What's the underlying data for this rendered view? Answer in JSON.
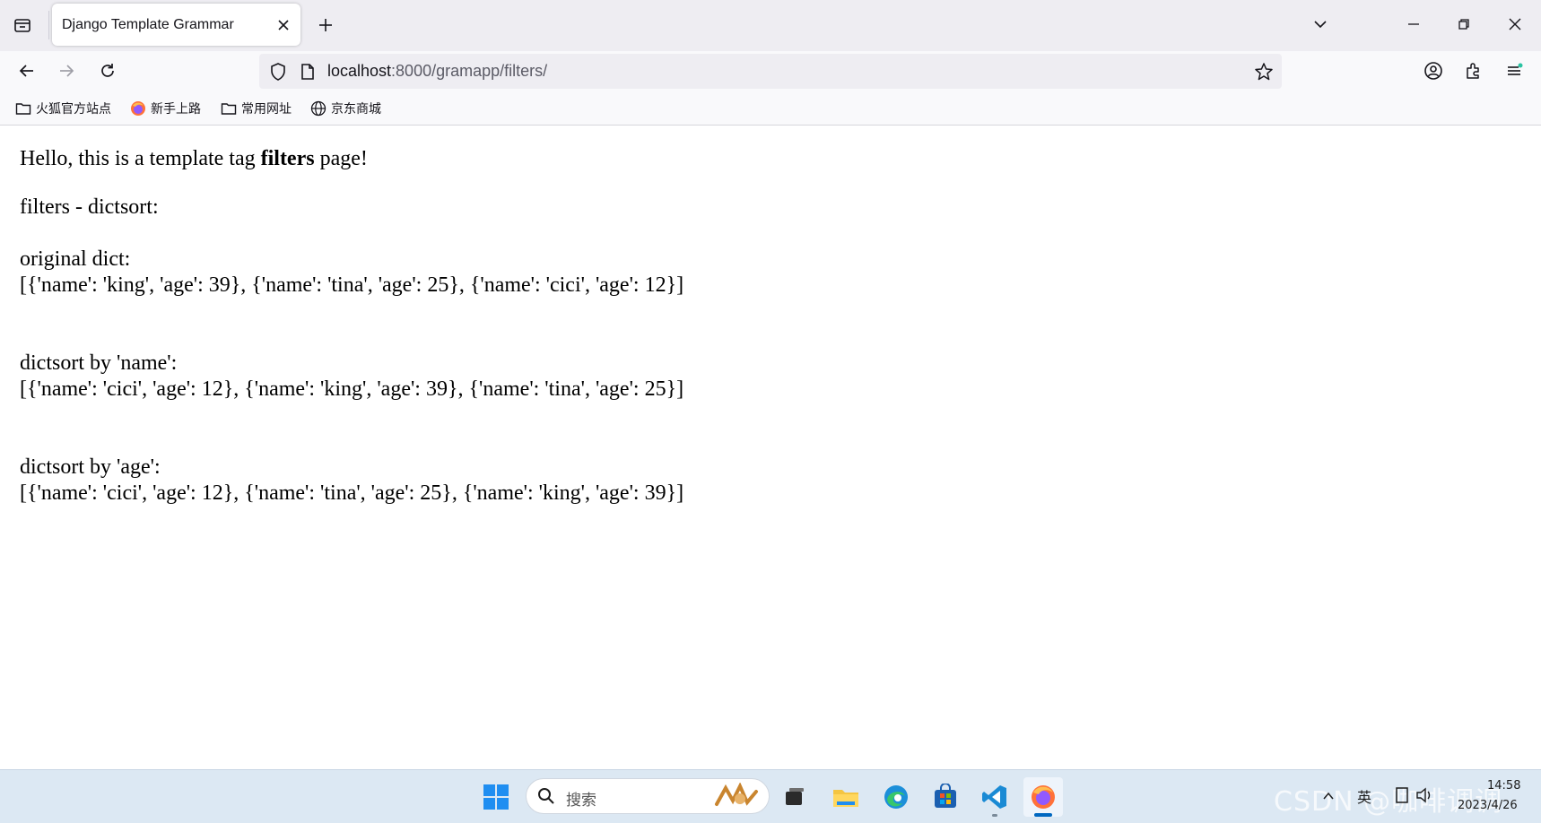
{
  "tab": {
    "title": "Django Template Grammar"
  },
  "address_bar": {
    "host": "localhost",
    "path": ":8000/gramapp/filters/"
  },
  "bookmarks": [
    {
      "label": "火狐官方站点",
      "icon": "folder-icon"
    },
    {
      "label": "新手上路",
      "icon": "firefox-icon"
    },
    {
      "label": "常用网址",
      "icon": "folder-icon"
    },
    {
      "label": "京东商城",
      "icon": "globe-icon"
    }
  ],
  "page": {
    "intro_before": "Hello, this is a template tag ",
    "intro_bold": "filters",
    "intro_after": " page!",
    "section_title": "filters - dictsort:",
    "original_label": "original dict:",
    "original_value": "[{'name': 'king', 'age': 39}, {'name': 'tina', 'age': 25}, {'name': 'cici', 'age': 12}]",
    "by_name_label": "dictsort by 'name':",
    "by_name_value": "[{'name': 'cici', 'age': 12}, {'name': 'king', 'age': 39}, {'name': 'tina', 'age': 25}]",
    "by_age_label": "dictsort by 'age':",
    "by_age_value": "[{'name': 'cici', 'age': 12}, {'name': 'tina', 'age': 25}, {'name': 'king', 'age': 39}]"
  },
  "taskbar": {
    "search_placeholder": "搜索",
    "tray_lang": "英",
    "time": "14:58",
    "date": "2023/4/26",
    "watermark": "CSDN @咖啡调调"
  },
  "colors": {
    "accent": "#0067c0",
    "tabstrip_bg": "#eeedf2",
    "toolbar_bg": "#f9f9fb",
    "taskbar_bg": "#dce8f3"
  }
}
